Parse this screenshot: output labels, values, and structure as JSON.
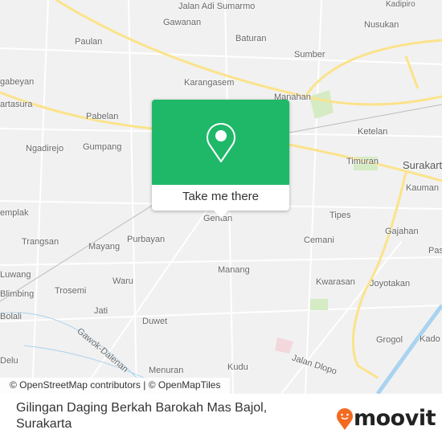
{
  "map": {
    "labels": [
      "Jalan Adi Sumarmo",
      "Kadipiro",
      "Gawanan",
      "Nusukan",
      "Paulan",
      "Baturan",
      "Sumber",
      "gabeyan",
      "Karangasem",
      "Manahan",
      "Pabelan",
      "artasura",
      "Ketelan",
      "Gumpang",
      "Ngadirejo",
      "Timuran",
      "Surakarta",
      "Kauman",
      "emplak",
      "Tipes",
      "Gajahan",
      "Trangsan",
      "Mayang",
      "Purbayan",
      "Gentan",
      "Cemani",
      "Pas",
      "Luwang",
      "Manang",
      "Waru",
      "Kwarasan",
      "Joyotakan",
      "Trosemi",
      "Blimbing",
      "Jati",
      "Bolali",
      "Duwet",
      "Grogol",
      "Kado",
      "Jalan Dlopo",
      "Gawok-Dalenan",
      "Menuran",
      "Kudu",
      "Delu"
    ],
    "attribution": "© OpenStreetMap contributors | © OpenMapTiles"
  },
  "popup": {
    "icon": "map-pin-icon",
    "cta": "Take me there",
    "color": "#1fb869"
  },
  "footer": {
    "place_line1": "Gilingan Daging Berkah Barokah Mas Bajol,",
    "place_line2": "Surakarta",
    "brand": "moovit",
    "brand_color": "#f26b21"
  }
}
